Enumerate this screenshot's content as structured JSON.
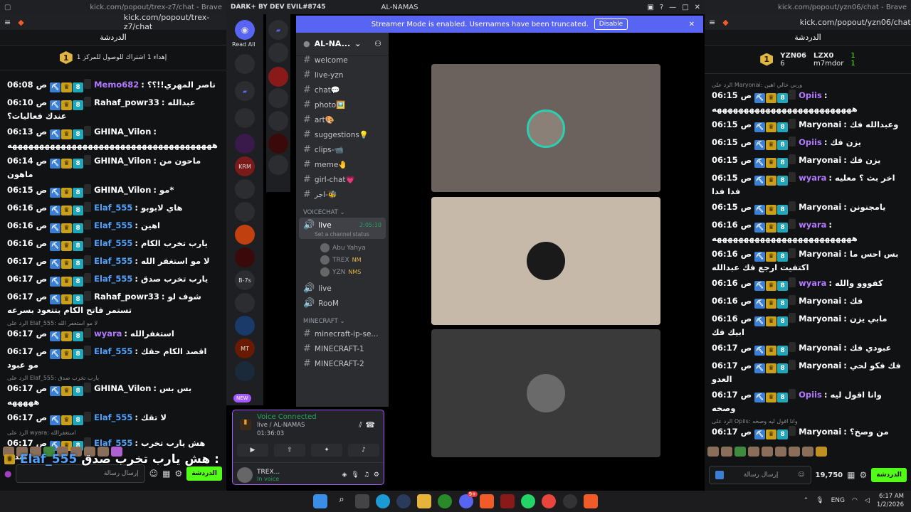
{
  "left_window": {
    "title": "kick.com/popout/trex-z7/chat - Brave",
    "url": "kick.com/popout/trex-z7/chat",
    "header": "الدردشة",
    "pinned": {
      "rank": "1",
      "text": "إهداء 1 اشتراك للوصول للمركز 1"
    },
    "messages": [
      {
        "reply": "",
        "time": "06:08 ص",
        "user": "Memo682",
        "ucolor": "#b37aff",
        "text": "ناصر المهري!!؟؟"
      },
      {
        "reply": "",
        "time": "06:10 ص",
        "user": "Rahaf_powr33",
        "ucolor": "#ffffff",
        "text": "عبدالله عندك فعاليات؟"
      },
      {
        "reply": "",
        "time": "06:13 ص",
        "user": "GHINA_Vilon",
        "ucolor": "#ffffff",
        "text": "ههههههههههههههههههههههههههههههههههههههه"
      },
      {
        "reply": "",
        "time": "06:14 ص",
        "user": "GHINA_Vilon",
        "ucolor": "#ffffff",
        "text": "ماحون من ماهون"
      },
      {
        "reply": "",
        "time": "06:15 ص",
        "user": "GHINA_Vilon",
        "ucolor": "#ffffff",
        "text": "مو*"
      },
      {
        "reply": "",
        "time": "06:16 ص",
        "user": "Elaf_555",
        "ucolor": "#4fa3ff",
        "text": "هاي لابوبو"
      },
      {
        "reply": "",
        "time": "06:16 ص",
        "user": "Elaf_555",
        "ucolor": "#4fa3ff",
        "text": "اهين"
      },
      {
        "reply": "",
        "time": "06:16 ص",
        "user": "Elaf_555",
        "ucolor": "#4fa3ff",
        "text": "يارب تخرب الكام"
      },
      {
        "reply": "",
        "time": "06:17 ص",
        "user": "Elaf_555",
        "ucolor": "#4fa3ff",
        "text": "لا مو استغفر الله"
      },
      {
        "reply": "",
        "time": "06:17 ص",
        "user": "Elaf_555",
        "ucolor": "#4fa3ff",
        "text": "يارب تخرب صدق"
      },
      {
        "reply": "",
        "time": "06:17 ص",
        "user": "Rahaf_powr33",
        "ucolor": "#ffffff",
        "text": "شوف لو تستمر فاتح الكام بتتعود بسرعه"
      },
      {
        "reply": "الرد على Elaf_555: لا مو استغفر الله",
        "time": "06:17 ص",
        "user": "wyara",
        "ucolor": "#b37aff",
        "text": "استغفرالله"
      },
      {
        "reply": "",
        "time": "06:17 ص",
        "user": "Elaf_555",
        "ucolor": "#4fa3ff",
        "text": "اقصد الكام حقك مو عبود"
      },
      {
        "reply": "الرد على Elaf_555: يارب تخرب صدق",
        "time": "06:17 ص",
        "user": "GHINA_Vilon",
        "ucolor": "#ffffff",
        "text": "بس بس هههههه"
      },
      {
        "reply": "",
        "time": "06:17 ص",
        "user": "Elaf_555",
        "ucolor": "#4fa3ff",
        "text": "لا تقك"
      },
      {
        "reply": "الرد على wyara: استغفرالله",
        "time": "06:17 ص",
        "user": "Elaf_555",
        "ucolor": "#4fa3ff",
        "text": "هش يارب تخرب صدق"
      }
    ],
    "input_placeholder": "إرسال رسالة",
    "chat_button": "الدردشة"
  },
  "overlay": {
    "user": "Elaf_555",
    "text": "هش يارب تخرب صدق :"
  },
  "discord": {
    "title": "AL-NAMAS",
    "plugin": "DARK+ BY DEV EVIL#8745",
    "read_all": "Read All",
    "streamer_banner": "Streamer Mode is enabled. Usernames have been truncated.",
    "disable": "Disable",
    "guild": "AL-NA...",
    "channels": [
      "welcome",
      "live-yzn",
      "chat💬",
      "photo🖼️",
      "art🎨",
      "suggestions💡",
      "clips-📹",
      "meme🤚",
      "girl-chat💗",
      "اجر-🐝"
    ],
    "voicechat_category": "VOICECHAT",
    "live_channel": "live",
    "live_timer": "2:05:10",
    "live_status": "Set a channel status",
    "voice_users": [
      {
        "name": "Abu Yahya",
        "tag": ""
      },
      {
        "name": "TREX",
        "tag": "NM"
      },
      {
        "name": "YZN",
        "tag": "NMS"
      }
    ],
    "voice_channels": [
      "live",
      "RooM"
    ],
    "minecraft_category": "MINECRAFT",
    "minecraft_channels": [
      "minecraft-ip-se...",
      "MINECRAFT-1",
      "MINECRAFT-2"
    ],
    "server_labels": [
      "KRM",
      "B-7s",
      "MT"
    ],
    "new_badge": "NEW",
    "voice_connected": "Voice Connected",
    "voice_path": "live / AL-NAMAS",
    "voice_time": "01:36:03",
    "me_name": "TREX...",
    "me_status": "In voice"
  },
  "right_window": {
    "title": "kick.com/popout/yzn06/chat - Brave",
    "url": "kick.com/popout/yzn06/chat",
    "header": "الدردشة",
    "leaders": [
      {
        "name": "YZN06",
        "count": "6"
      },
      {
        "name": "LZX0",
        "count": "1"
      },
      {
        "name": "m7mdor",
        "count": "1"
      }
    ],
    "messages": [
      {
        "reply": "الرد على Maryonai: وربي خالي اهين",
        "time": "06:15 ص",
        "user": "Opiis",
        "ucolor": "#b37aff",
        "text": "ههههههههههههههههههههههههههه"
      },
      {
        "reply": "",
        "time": "06:15 ص",
        "user": "Maryonai",
        "ucolor": "#ffffff",
        "text": "وعبدالله فك"
      },
      {
        "reply": "",
        "time": "06:15 ص",
        "user": "Opiis",
        "ucolor": "#b37aff",
        "text": "يزن فك"
      },
      {
        "reply": "",
        "time": "06:15 ص",
        "user": "Maryonai",
        "ucolor": "#ffffff",
        "text": "يزن فك"
      },
      {
        "reply": "",
        "time": "06:15 ص",
        "user": "wyara",
        "ucolor": "#b37aff",
        "text": "اخر بث ؟ معليه فدا فدا"
      },
      {
        "reply": "",
        "time": "06:15 ص",
        "user": "Maryonai",
        "ucolor": "#ffffff",
        "text": "يامجنونن"
      },
      {
        "reply": "",
        "time": "06:16 ص",
        "user": "wyara",
        "ucolor": "#b37aff",
        "text": "ههههههههههههههههههههههههههه"
      },
      {
        "reply": "",
        "time": "06:16 ص",
        "user": "Maryonai",
        "ucolor": "#ffffff",
        "text": "بس احس ما اكتفيت ارجع فك عبدالله"
      },
      {
        "reply": "",
        "time": "06:16 ص",
        "user": "wyara",
        "ucolor": "#b37aff",
        "text": "كفووو والله"
      },
      {
        "reply": "",
        "time": "06:16 ص",
        "user": "Maryonai",
        "ucolor": "#ffffff",
        "text": "فك"
      },
      {
        "reply": "",
        "time": "06:16 ص",
        "user": "Maryonai",
        "ucolor": "#ffffff",
        "text": "مابي يزن ابيك فك"
      },
      {
        "reply": "",
        "time": "06:17 ص",
        "user": "Maryonai",
        "ucolor": "#ffffff",
        "text": "عبودي فك"
      },
      {
        "reply": "",
        "time": "06:17 ص",
        "user": "Maryonai",
        "ucolor": "#ffffff",
        "text": "فك فكو لحي العدو"
      },
      {
        "reply": "",
        "time": "06:17 ص",
        "user": "Opiis",
        "ucolor": "#b37aff",
        "text": "وانا اقول ليه وصخه"
      },
      {
        "reply": "الرد على Opiis: وانا اقول ليه وصخه",
        "time": "06:17 ص",
        "user": "Maryonai",
        "ucolor": "#ffffff",
        "text": "من وصخ؟"
      }
    ],
    "input_placeholder": "إرسال رسالة",
    "points": "19,750",
    "chat_button": "الدردشة"
  },
  "taskbar": {
    "lang": "ENG",
    "time": "6:17 AM",
    "date": "1/2/2026",
    "discord_badge": "9+"
  }
}
